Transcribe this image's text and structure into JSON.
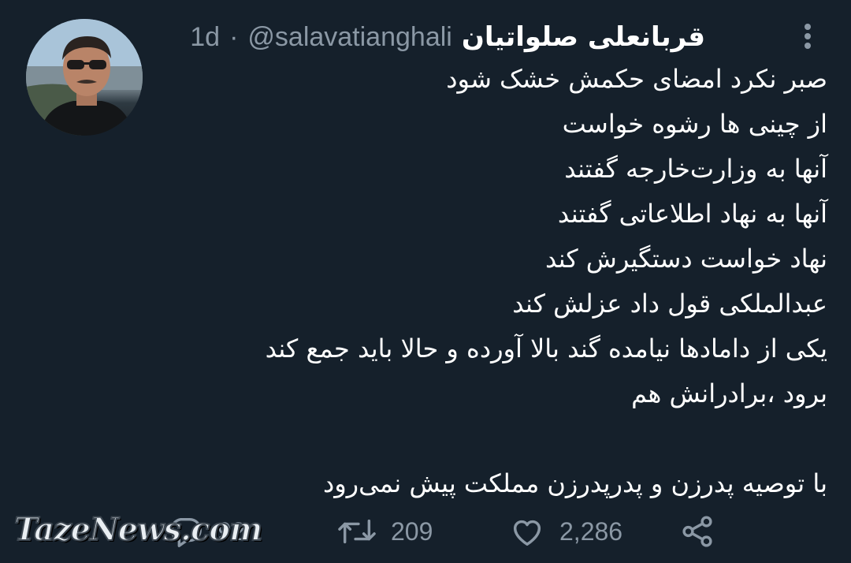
{
  "tweet": {
    "author": {
      "display_name": "قربانعلی صلواتیان",
      "handle": "@salavatianghali",
      "separator": "·",
      "time": "1d"
    },
    "lines": [
      "صبر نکرد امضای حکمش خشک شود",
      "از چینی ها رشوه خواست",
      "آنها به وزارت‌خارجه گفتند",
      "آنها به نهاد اطلاعاتی گفتند",
      "نهاد خواست دستگیرش کند",
      "عبدالملکی قول داد عزلش کند",
      "یکی از دامادها نیامده گند بالا آورده و حالا باید جمع کند",
      "برود ،برادرانش هم",
      "",
      "با توصیه پدرزن و پدرپدرزن مملکت پیش نمی‌رود"
    ],
    "stats": {
      "replies": "92",
      "retweets": "209",
      "likes": "2,286"
    }
  },
  "watermark": "TazeNews.com",
  "icons": {
    "more": "more-vertical-icon",
    "reply": "reply-icon",
    "retweet": "retweet-icon",
    "like": "heart-icon",
    "share": "share-icon"
  },
  "colors": {
    "background": "#15202b",
    "text_primary": "#ffffff",
    "text_secondary": "#8b98a5"
  }
}
